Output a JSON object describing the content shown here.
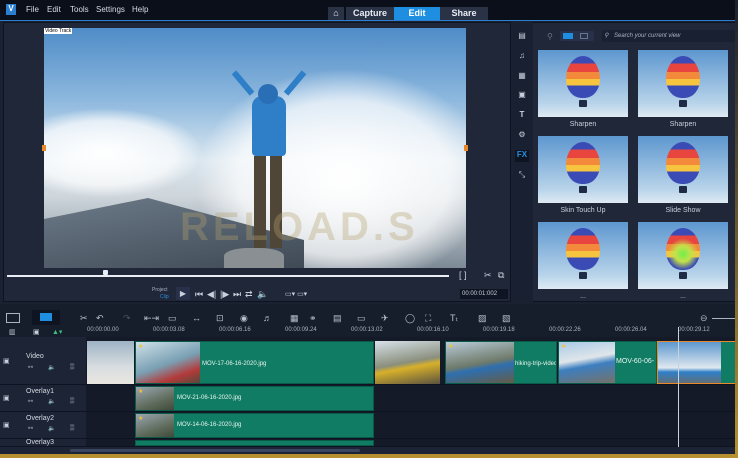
{
  "menu": {
    "items": [
      "File",
      "Edit",
      "Tools",
      "Settings",
      "Help"
    ]
  },
  "tabs": {
    "home": "⌂",
    "capture": "Capture",
    "edit": "Edit",
    "share": "Share",
    "active": "Edit"
  },
  "preview": {
    "overlay_label": "Video Track",
    "project_label": "Project",
    "clip_label": "Clip",
    "timecode": "00:00:01:002",
    "scrubber_position": 0.2
  },
  "library": {
    "search_placeholder": "Search your current view",
    "items": [
      {
        "label": "Sharpen"
      },
      {
        "label": "Sharpen"
      },
      {
        "label": "Skin Touch Up"
      },
      {
        "label": "Slide Show"
      },
      {
        "label": "..."
      },
      {
        "label": "..."
      }
    ],
    "side_icons": [
      "media-icon",
      "audio-icon",
      "instant-project-icon",
      "template-icon",
      "title-icon",
      "transition-icon",
      "fx-icon",
      "path-icon"
    ],
    "fx_label": "FX"
  },
  "watermark": "RELOAD.S",
  "timeline": {
    "ruler": [
      "00:00:00.00",
      "00:00:03.08",
      "00:00:06.16",
      "00:00:09.24",
      "00:00:13.02",
      "00:00:16.10",
      "00:00:19.18",
      "00:00:22.26",
      "00:00:26.04",
      "00:00:29.12"
    ],
    "tracks": [
      {
        "name": "Video"
      },
      {
        "name": "Overlay1"
      },
      {
        "name": "Overlay2"
      },
      {
        "name": "Overlay3"
      }
    ],
    "clips": {
      "v1": "MOV-17-06-16-2020.jpg",
      "v2": "hiking-trip-video",
      "v3": "MOV-60-06-",
      "o1": "MOV-21-06-16-2020.jpg",
      "o2": "MOV-14-06-16-2020.jpg"
    }
  },
  "colors": {
    "accent": "#1e8fe0",
    "clip": "#0f7c63",
    "bg": "#1a2131"
  }
}
